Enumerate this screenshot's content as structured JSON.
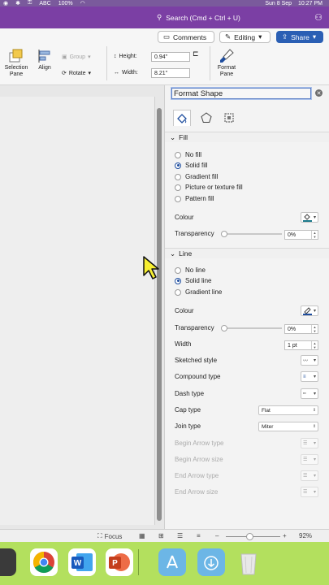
{
  "menubar": {
    "keyboard_label": "ABC",
    "battery": "100%",
    "date": "Sun 8 Sep",
    "time": "10:27 PM"
  },
  "titlebar": {
    "search_placeholder": "Search (Cmd + Ctrl + U)"
  },
  "ribbon": {
    "comments_label": "Comments",
    "editing_label": "Editing",
    "share_label": "Share",
    "selection_pane_label": "Selection Pane",
    "align_label": "Align",
    "group_label": "Group",
    "rotate_label": "Rotate",
    "height_label": "Height:",
    "height_value": "0.94\"",
    "width_label": "Width:",
    "width_value": "8.21\"",
    "format_pane_label": "Format Pane"
  },
  "pane": {
    "title": "Format Shape",
    "fill": {
      "header": "Fill",
      "options": [
        "No fill",
        "Solid fill",
        "Gradient fill",
        "Picture or texture fill",
        "Pattern fill"
      ],
      "selected_index": 1,
      "colour_label": "Colour",
      "colour_value": "#1c7a8c",
      "transparency_label": "Transparency",
      "transparency_value": "0%"
    },
    "line": {
      "header": "Line",
      "options": [
        "No line",
        "Solid line",
        "Gradient line"
      ],
      "selected_index": 1,
      "colour_label": "Colour",
      "colour_value": "#1f4e9f",
      "transparency_label": "Transparency",
      "transparency_value": "0%",
      "width_label": "Width",
      "width_value": "1 pt",
      "sketched_label": "Sketched style",
      "compound_label": "Compound type",
      "dash_label": "Dash type",
      "cap_label": "Cap type",
      "cap_value": "Flat",
      "join_label": "Join type",
      "join_value": "Miter",
      "begin_type_label": "Begin Arrow type",
      "begin_size_label": "Begin Arrow size",
      "end_type_label": "End Arrow type",
      "end_size_label": "End Arrow size"
    }
  },
  "statusbar": {
    "focus_label": "Focus",
    "zoom_value": "92%"
  },
  "colors": {
    "title_bar": "#7b3fa4",
    "accent_blue": "#2b5fb4",
    "dock": "#b3e05e"
  }
}
